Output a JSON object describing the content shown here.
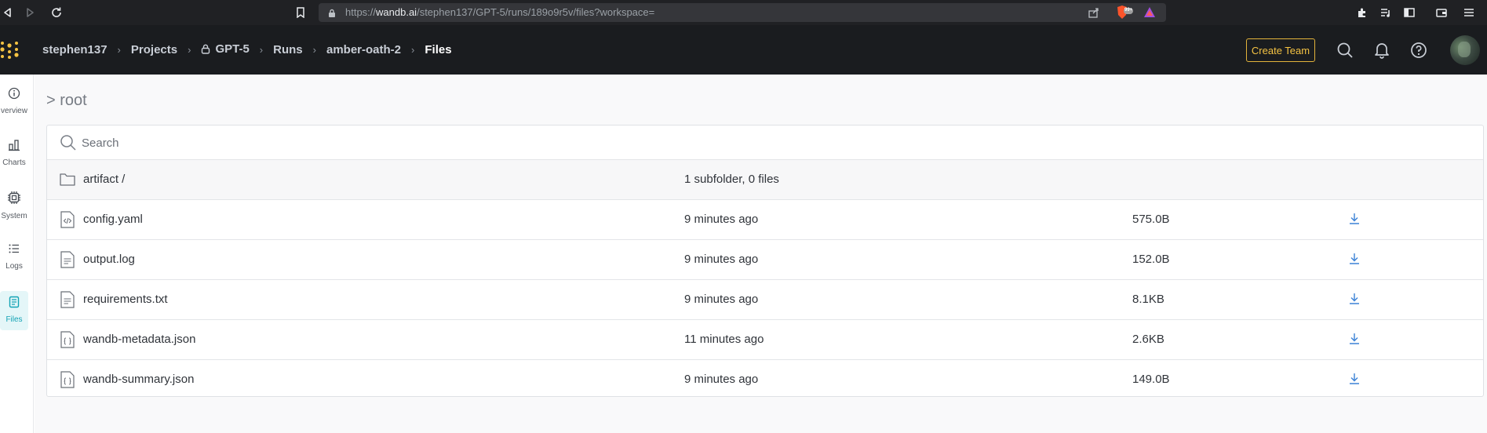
{
  "browser": {
    "url_prefix": "https://",
    "url_host": "wandb.ai",
    "url_path": "/stephen137/GPT-5/runs/189o9r5v/files?workspace=",
    "brave_badge": "99+"
  },
  "header": {
    "breadcrumbs": [
      {
        "label": "stephen137"
      },
      {
        "label": "Projects"
      },
      {
        "label": "GPT-5"
      },
      {
        "label": "Runs"
      },
      {
        "label": "amber-oath-2"
      },
      {
        "label": "Files"
      }
    ],
    "create_team_label": "Create Team"
  },
  "sidebar": {
    "items": [
      {
        "label": "verview",
        "icon": "info-icon"
      },
      {
        "label": "Charts",
        "icon": "bar-chart-icon"
      },
      {
        "label": "System",
        "icon": "chip-icon"
      },
      {
        "label": "Logs",
        "icon": "list-icon"
      },
      {
        "label": "Files",
        "icon": "file-icon",
        "active": true
      }
    ]
  },
  "main": {
    "root_path": "> root",
    "search_placeholder": "Search",
    "folder": {
      "name": "artifact /",
      "meta": "1 subfolder, 0 files"
    },
    "files": [
      {
        "name": "config.yaml",
        "modified": "9 minutes ago",
        "size": "575.0B",
        "icon": "code-file-icon"
      },
      {
        "name": "output.log",
        "modified": "9 minutes ago",
        "size": "152.0B",
        "icon": "text-file-icon"
      },
      {
        "name": "requirements.txt",
        "modified": "9 minutes ago",
        "size": "8.1KB",
        "icon": "text-file-icon"
      },
      {
        "name": "wandb-metadata.json",
        "modified": "11 minutes ago",
        "size": "2.6KB",
        "icon": "json-file-icon"
      },
      {
        "name": "wandb-summary.json",
        "modified": "9 minutes ago",
        "size": "149.0B",
        "icon": "json-file-icon"
      }
    ]
  },
  "colors": {
    "accent": "#13a3b5",
    "create_team": "#f5c343",
    "download": "#3b82d6",
    "header_bg": "#1a1c1f"
  }
}
